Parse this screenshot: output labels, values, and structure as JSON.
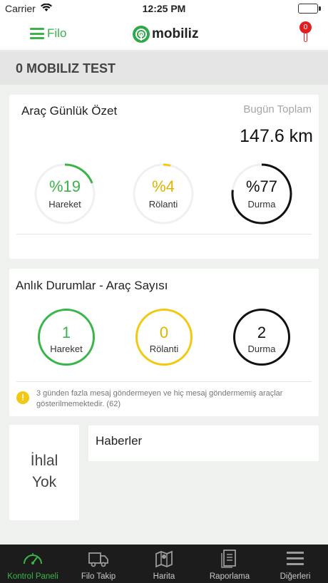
{
  "status_bar": {
    "carrier": "Carrier",
    "time": "12:25 PM"
  },
  "navbar": {
    "menu_label": "Filo",
    "logo_text": "mobiliz",
    "alarm_count": "0"
  },
  "page": {
    "title": "0 MOBILIZ TEST"
  },
  "daily_summary": {
    "heading": "Araç Günlük Özet",
    "today_label": "Bugün Toplam",
    "distance": "147.6 km",
    "rings": [
      {
        "percent_text": "%19",
        "label": "Hareket",
        "value": 0.19,
        "color": "#39b54a"
      },
      {
        "percent_text": "%4",
        "label": "Rölanti",
        "value": 0.04,
        "color": "#f2c811"
      },
      {
        "percent_text": "%77",
        "label": "Durma",
        "value": 0.77,
        "color": "#111111"
      }
    ]
  },
  "instant_status": {
    "heading": "Anlık Durumlar - Araç Sayısı",
    "counts": [
      {
        "value": "1",
        "label": "Hareket",
        "color": "#39b54a"
      },
      {
        "value": "0",
        "label": "Rölanti",
        "color": "#f2c811"
      },
      {
        "value": "2",
        "label": "Durma",
        "color": "#111111"
      }
    ],
    "warning_icon": "exclamation-icon",
    "warning_text": "3 günden fazla mesaj göndermeyen ve hiç mesaj göndermemiş araçlar gösterilmemektedir. (62)"
  },
  "violation": {
    "line1": "İhlal",
    "line2": "Yok"
  },
  "news": {
    "heading": "Haberler"
  },
  "tabs": [
    {
      "label": "Kontrol Paneli",
      "icon": "gauge-icon",
      "active": true
    },
    {
      "label": "Filo Takip",
      "icon": "truck-icon",
      "active": false
    },
    {
      "label": "Harita",
      "icon": "map-icon",
      "active": false
    },
    {
      "label": "Raporlama",
      "icon": "report-icon",
      "active": false
    },
    {
      "label": "Diğerleri",
      "icon": "menu-icon",
      "active": false
    }
  ],
  "colors": {
    "accent": "#39b54a",
    "idle": "#f2c811",
    "stop": "#111111",
    "alarm": "#e02020"
  }
}
